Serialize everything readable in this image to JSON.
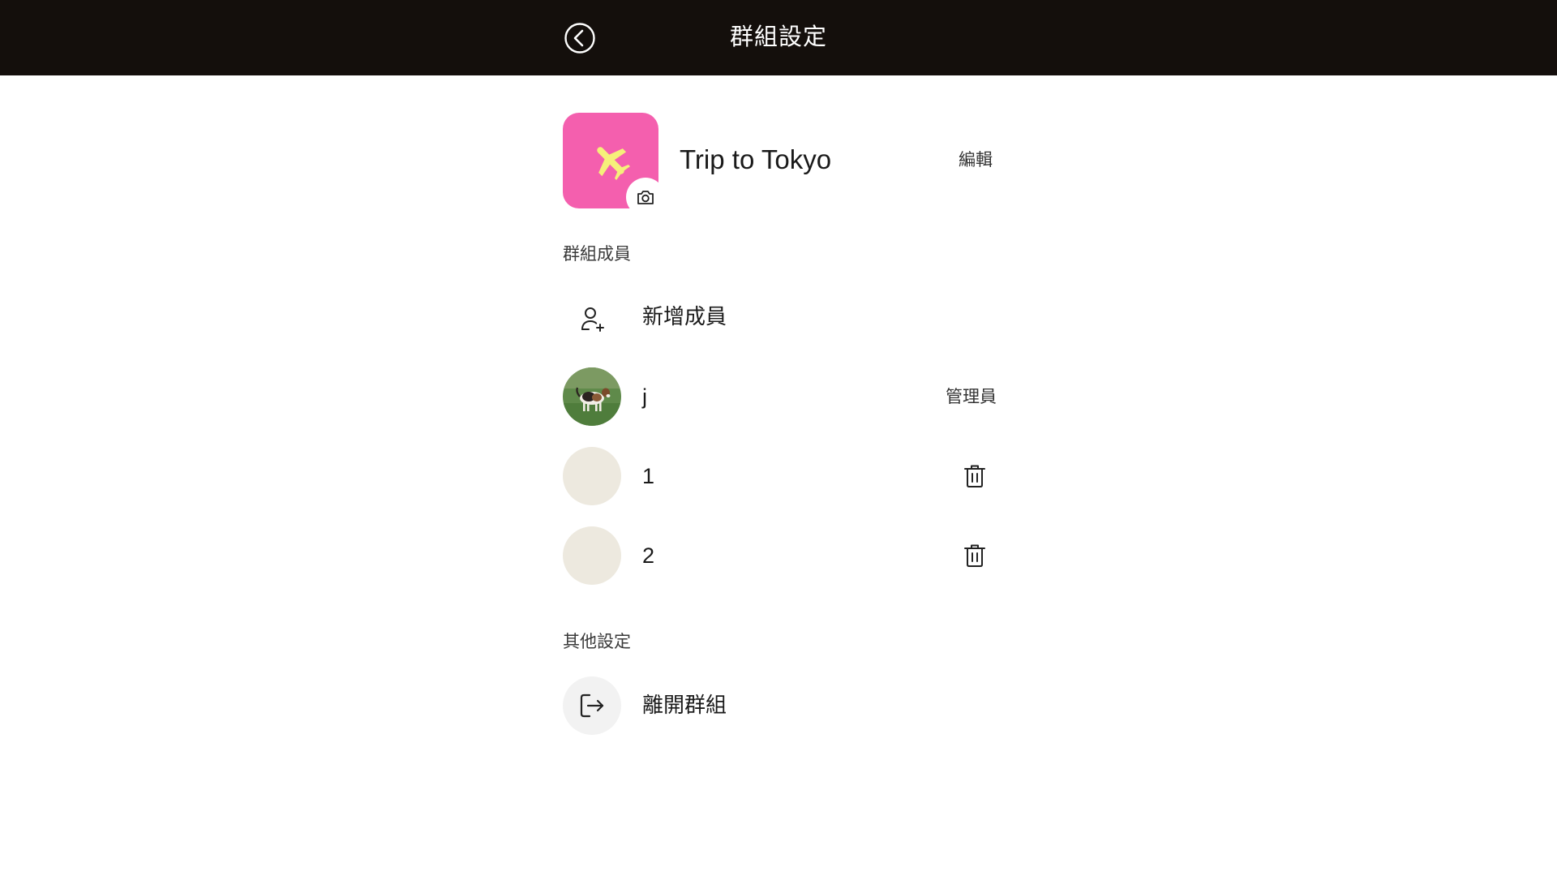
{
  "header": {
    "title": "群組設定",
    "back_icon": "chevron-left-circle-icon"
  },
  "group": {
    "name": "Trip to Tokyo",
    "edit_label": "編輯",
    "avatar_color": "#f45fae",
    "avatar_icon": "airplane-icon",
    "avatar_icon_color": "#f6f07a",
    "camera_icon": "camera-icon"
  },
  "members_section": {
    "label": "群組成員",
    "add_member_label": "新增成員",
    "add_member_icon": "user-plus-icon",
    "members": [
      {
        "name": "j",
        "role": "管理員",
        "avatar": "dog-photo"
      },
      {
        "name": "1",
        "action_icon": "trash-icon"
      },
      {
        "name": "2",
        "action_icon": "trash-icon"
      }
    ]
  },
  "other_section": {
    "label": "其他設定",
    "leave_group_label": "離開群組",
    "leave_icon": "logout-icon"
  },
  "colors": {
    "topbar": "#140f0c",
    "placeholder_avatar": "#ede9df"
  }
}
